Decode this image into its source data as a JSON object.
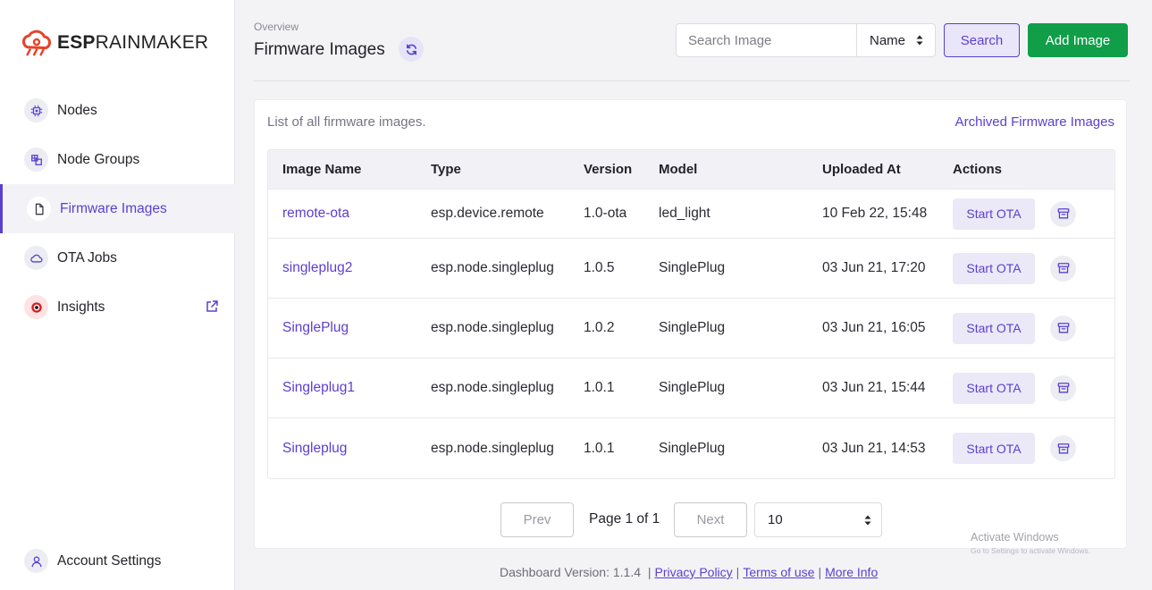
{
  "brand": {
    "bold": "ESP",
    "light": "RAINMAKER",
    "accent": "#e8422a"
  },
  "sidebar": {
    "items": [
      {
        "label": "Nodes",
        "icon": "chip-icon"
      },
      {
        "label": "Node Groups",
        "icon": "groups-icon"
      },
      {
        "label": "Firmware Images",
        "icon": "file-icon",
        "active": true
      },
      {
        "label": "OTA Jobs",
        "icon": "cloud-icon"
      },
      {
        "label": "Insights",
        "icon": "insights-icon"
      }
    ],
    "account_label": "Account Settings"
  },
  "header": {
    "breadcrumb": "Overview",
    "title": "Firmware Images",
    "search_placeholder": "Search Image",
    "search_filter": "Name",
    "search_button": "Search",
    "add_button": "Add Image"
  },
  "card": {
    "description": "List of all firmware images.",
    "archived_link": "Archived Firmware Images"
  },
  "table": {
    "headers": [
      "Image Name",
      "Type",
      "Version",
      "Model",
      "Uploaded At",
      "Actions"
    ],
    "action_label": "Start OTA",
    "rows": [
      {
        "name": "remote-ota",
        "type": "esp.device.remote",
        "version": "1.0-ota",
        "model": "led_light",
        "uploaded": "10 Feb 22, 15:48"
      },
      {
        "name": "singleplug2",
        "type": "esp.node.singleplug",
        "version": "1.0.5",
        "model": "SinglePlug",
        "uploaded": "03 Jun 21, 17:20"
      },
      {
        "name": "SinglePlug",
        "type": "esp.node.singleplug",
        "version": "1.0.2",
        "model": "SinglePlug",
        "uploaded": "03 Jun 21, 16:05"
      },
      {
        "name": "Singleplug1",
        "type": "esp.node.singleplug",
        "version": "1.0.1",
        "model": "SinglePlug",
        "uploaded": "03 Jun 21, 15:44"
      },
      {
        "name": "Singleplug",
        "type": "esp.node.singleplug",
        "version": "1.0.1",
        "model": "SinglePlug",
        "uploaded": "03 Jun 21, 14:53"
      }
    ]
  },
  "pagination": {
    "prev": "Prev",
    "next": "Next",
    "label": "Page 1 of 1",
    "page_size": "10"
  },
  "watermark": {
    "line1": "Activate Windows",
    "line2": "Go to Settings to activate Windows."
  },
  "footer": {
    "version": "Dashboard Version: 1.1.4",
    "privacy": "Privacy Policy",
    "terms": "Terms of use",
    "more": "More Info"
  },
  "colors": {
    "primary": "#5b3fd0",
    "success": "#109e48"
  }
}
